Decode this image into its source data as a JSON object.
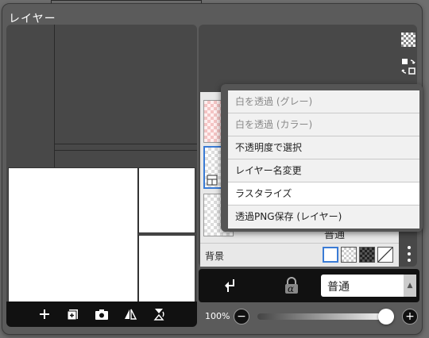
{
  "panel": {
    "title": "レイヤー"
  },
  "preview_toolbar": {
    "icons": [
      "add-layer-icon",
      "add-material-icon",
      "camera-icon",
      "flip-icon",
      "rotate-icon"
    ]
  },
  "layers": {
    "blend_mode_label": "普通",
    "background_label": "背景",
    "background_options": [
      "white",
      "transparent-light",
      "transparent-dark",
      "none"
    ]
  },
  "menu": {
    "items": [
      {
        "label": "白を透過 (グレー)",
        "enabled": false
      },
      {
        "label": "白を透過 (カラー)",
        "enabled": false
      },
      {
        "label": "不透明度で選択",
        "enabled": true
      },
      {
        "label": "レイヤー名変更",
        "enabled": true
      },
      {
        "label": "ラスタライズ",
        "enabled": true
      },
      {
        "label": "透過PNG保存 (レイヤー)",
        "enabled": true
      }
    ]
  },
  "mode_bar": {
    "blend_mode": "普通",
    "alpha_lock_glyph": "α"
  },
  "opacity": {
    "label": "100%",
    "value": 1.0,
    "minus": "−",
    "plus": "+"
  },
  "colors": {
    "accent": "#3a7bd5",
    "panel_bg": "#5b5b5b"
  }
}
